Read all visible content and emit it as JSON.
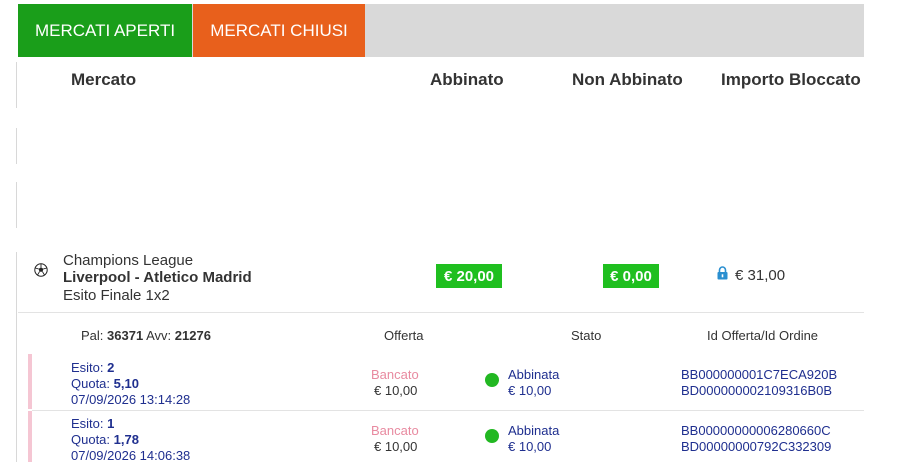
{
  "tabs": {
    "open": "MERCATI APERTI",
    "closed": "MERCATI CHIUSI"
  },
  "columns": {
    "market": "Mercato",
    "matched": "Abbinato",
    "unmatched": "Non Abbinato",
    "blocked": "Importo Bloccato"
  },
  "market": {
    "competition": "Champions League",
    "event": "Liverpool - Atletico Madrid",
    "market_name": "Esito Finale 1x2",
    "matched": "€ 20,00",
    "unmatched": "€ 0,00",
    "blocked": "€ 31,00"
  },
  "subheader": {
    "pal_label": "Pal:",
    "pal": "36371",
    "avv_label": "Avv:",
    "avv": "21276",
    "offer": "Offerta",
    "status": "Stato",
    "ids": "Id Offerta/Id Ordine"
  },
  "bets": [
    {
      "esito_label": "Esito:",
      "esito": "2",
      "quota_label": "Quota:",
      "quota": "5,10",
      "datetime": "07/09/2026 13:14:28",
      "offer_type": "Bancato",
      "offer_amount": "€ 10,00",
      "status": "Abbinata",
      "status_amount": "€ 10,00",
      "offer_id": "BB000000001C7ECA920B",
      "order_id": "BD000000002109316B0B"
    },
    {
      "esito_label": "Esito:",
      "esito": "1",
      "quota_label": "Quota:",
      "quota": "1,78",
      "datetime": "07/09/2026 14:06:38",
      "offer_type": "Bancato",
      "offer_amount": "€ 10,00",
      "status": "Abbinata",
      "status_amount": "€ 10,00",
      "offer_id": "BB00000000006280660C",
      "order_id": "BD00000000792C332309"
    }
  ]
}
